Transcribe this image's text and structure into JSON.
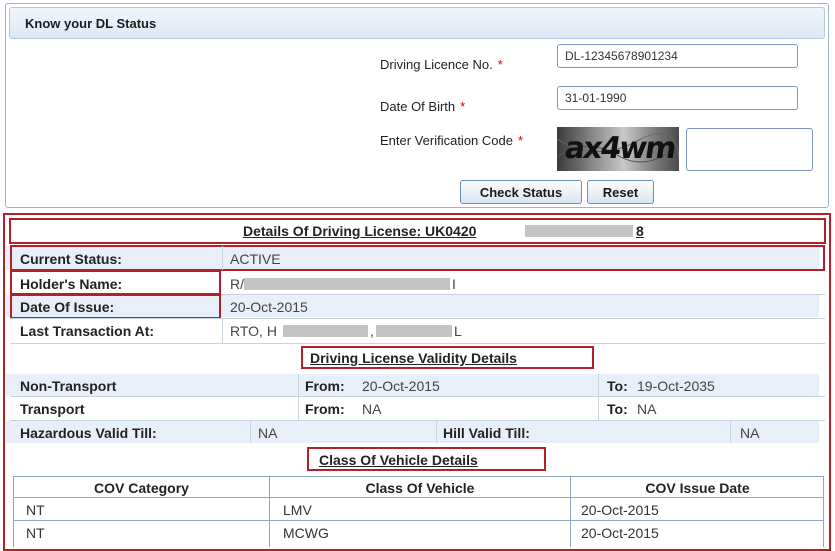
{
  "form": {
    "title": "Know your DL Status",
    "dl_label": "Driving Licence No.",
    "dob_label": "Date Of Birth",
    "code_label": "Enter Verification Code",
    "required_mark": "*",
    "dl_value": "DL-12345678901234",
    "dob_value": "31-01-1990",
    "captcha_text": "ax4wm",
    "check_button": "Check Status",
    "reset_button": "Reset"
  },
  "details": {
    "title": "Details Of Driving License: UK0420",
    "title_suffix": "8",
    "current_status_label": "Current Status:",
    "current_status_value": "ACTIVE",
    "holder_name_label": "Holder's Name:",
    "holder_name_prefix": "R/",
    "holder_name_suffix": "I",
    "date_of_issue_label": "Date Of Issue:",
    "date_of_issue_value": "20-Oct-2015",
    "last_transaction_label": "Last Transaction At:",
    "last_transaction_prefix": "RTO, H",
    "last_transaction_mid": ",",
    "last_transaction_suffix": "L"
  },
  "validity": {
    "title": "Driving License Validity Details",
    "non_transport_label": "Non-Transport",
    "non_transport_from_label": "From:",
    "non_transport_from_value": "20-Oct-2015",
    "non_transport_to_label": "To:",
    "non_transport_to_value": "19-Oct-2035",
    "transport_label": "Transport",
    "transport_from_label": "From:",
    "transport_from_value": "NA",
    "transport_to_label": "To:",
    "transport_to_value": "NA",
    "hazardous_label": "Hazardous Valid Till:",
    "hazardous_value": "NA",
    "hill_label": "Hill Valid Till:",
    "hill_value": "NA"
  },
  "cov": {
    "title": "Class Of Vehicle Details",
    "headers": [
      "COV Category",
      "Class Of Vehicle",
      "COV Issue Date"
    ],
    "rows": [
      [
        "NT",
        "LMV",
        "20-Oct-2015"
      ],
      [
        "NT",
        "MCWG",
        "20-Oct-2015"
      ]
    ]
  },
  "colors": {
    "accent_red": "#b3202a",
    "header_blue": "#dde8f5",
    "row_shade": "#e9eff8"
  }
}
